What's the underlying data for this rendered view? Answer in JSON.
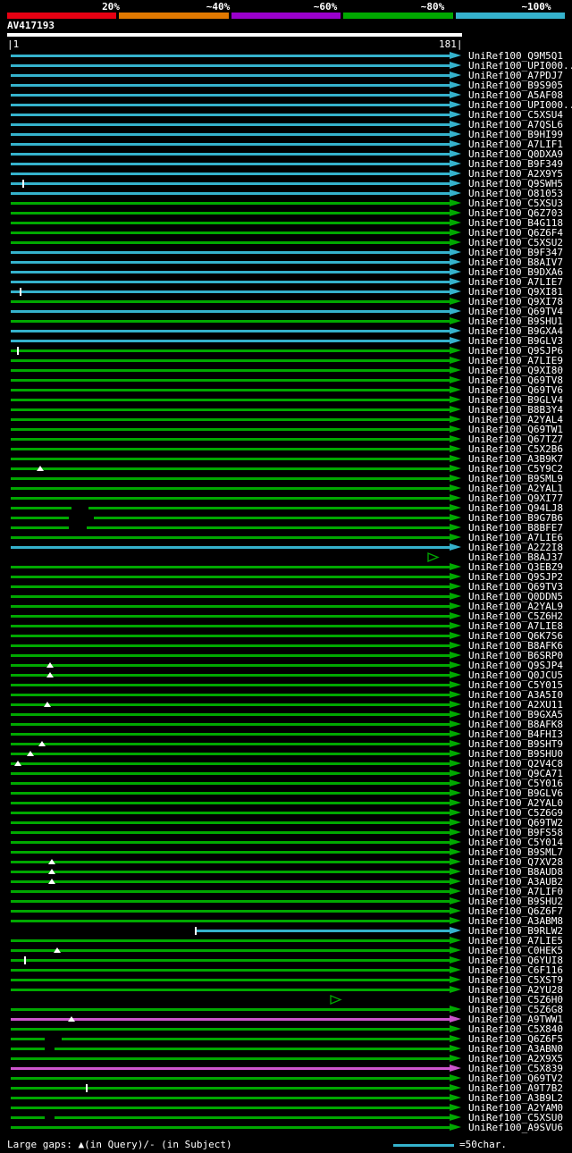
{
  "chart_data": {
    "type": "table",
    "title": "AV417193 similarity search graphical overview",
    "query_name": "AV417193",
    "ruler_left": "|1",
    "ruler_right": "181|",
    "x_range": [
      1,
      181
    ],
    "scale_labels": [
      "20%",
      "~40%",
      "~60%",
      "~80%",
      "~100%"
    ],
    "scale_colors": [
      "#e60012",
      "#e07800",
      "#9a00cc",
      "#00a800",
      "#35b2cc"
    ],
    "color_classes": {
      "cyan": "#35b2cc",
      "green": "#00a800",
      "magenta": "#cc55cc"
    },
    "legend_gaps": "Large gaps: ▲(in Query)/- (in Subject)",
    "legend_scale_label": "=50char.",
    "legend_scale_color": "#35b2cc",
    "rows": [
      {
        "label": "UniRef100_Q9M5Q1",
        "color": "cyan"
      },
      {
        "label": "UniRef100_UPI000...",
        "color": "cyan"
      },
      {
        "label": "UniRef100_A7PDJ7",
        "color": "cyan"
      },
      {
        "label": "UniRef100_B9S905",
        "color": "cyan"
      },
      {
        "label": "UniRef100_A5AF08",
        "color": "cyan"
      },
      {
        "label": "UniRef100_UPI000...",
        "color": "cyan"
      },
      {
        "label": "UniRef100_C5XSU4",
        "color": "cyan"
      },
      {
        "label": "UniRef100_A7QSL6",
        "color": "cyan"
      },
      {
        "label": "UniRef100_B9HI99",
        "color": "cyan"
      },
      {
        "label": "UniRef100_A7LIF1",
        "color": "cyan"
      },
      {
        "label": "UniRef100_Q0DXA9",
        "color": "cyan"
      },
      {
        "label": "UniRef100_B9F349",
        "color": "cyan"
      },
      {
        "label": "UniRef100_A2X9Y5",
        "color": "cyan"
      },
      {
        "label": "UniRef100_Q9SWH5",
        "color": "cyan",
        "ticks": [
          6
        ]
      },
      {
        "label": "UniRef100_O81053",
        "color": "cyan"
      },
      {
        "label": "UniRef100_C5XSU3",
        "color": "green"
      },
      {
        "label": "UniRef100_Q6Z703",
        "color": "green"
      },
      {
        "label": "UniRef100_B4G118",
        "color": "green"
      },
      {
        "label": "UniRef100_Q6Z6F4",
        "color": "green"
      },
      {
        "label": "UniRef100_C5XSU2",
        "color": "green"
      },
      {
        "label": "UniRef100_B9F347",
        "color": "cyan"
      },
      {
        "label": "UniRef100_B8AIV7",
        "color": "cyan"
      },
      {
        "label": "UniRef100_B9DXA6",
        "color": "cyan"
      },
      {
        "label": "UniRef100_A7LIE7",
        "color": "cyan"
      },
      {
        "label": "UniRef100_Q9XI81",
        "color": "cyan",
        "ticks": [
          5
        ]
      },
      {
        "label": "UniRef100_Q9XI78",
        "color": "green"
      },
      {
        "label": "UniRef100_Q69TV4",
        "color": "cyan"
      },
      {
        "label": "UniRef100_B9SHU1",
        "color": "green"
      },
      {
        "label": "UniRef100_B9GXA4",
        "color": "cyan"
      },
      {
        "label": "UniRef100_B9GLV3",
        "color": "cyan"
      },
      {
        "label": "UniRef100_Q9SJP6",
        "color": "green",
        "ticks": [
          4
        ]
      },
      {
        "label": "UniRef100_A7LIE9",
        "color": "green"
      },
      {
        "label": "UniRef100_Q9XI80",
        "color": "green"
      },
      {
        "label": "UniRef100_Q69TV8",
        "color": "green"
      },
      {
        "label": "UniRef100_Q69TV6",
        "color": "green"
      },
      {
        "label": "UniRef100_B9GLV4",
        "color": "green"
      },
      {
        "label": "UniRef100_B8B3Y4",
        "color": "green"
      },
      {
        "label": "UniRef100_A2YAL4",
        "color": "green"
      },
      {
        "label": "UniRef100_Q69TW1",
        "color": "green"
      },
      {
        "label": "UniRef100_Q67TZ7",
        "color": "green"
      },
      {
        "label": "UniRef100_C5X2B6",
        "color": "green"
      },
      {
        "label": "UniRef100_A3B9K7",
        "color": "green"
      },
      {
        "label": "UniRef100_C5Y9C2",
        "color": "green",
        "tris": [
          13
        ]
      },
      {
        "label": "UniRef100_B9SML9",
        "color": "green"
      },
      {
        "label": "UniRef100_A2YAL1",
        "color": "green"
      },
      {
        "label": "UniRef100_Q9XI77",
        "color": "green"
      },
      {
        "label": "UniRef100_Q94LJ8",
        "color": "green",
        "gaps": [
          [
            26,
            33
          ]
        ]
      },
      {
        "label": "UniRef100_B9G7B6",
        "color": "green",
        "gaps": [
          [
            25,
            35
          ]
        ]
      },
      {
        "label": "UniRef100_B8BFE7",
        "color": "green",
        "gaps": [
          [
            25,
            32
          ]
        ]
      },
      {
        "label": "UniRef100_A7LIE6",
        "color": "green"
      },
      {
        "label": "UniRef100_A2Z2I8",
        "color": "cyan"
      },
      {
        "label": "UniRef100_B8AJ37",
        "color": "green",
        "bar": null,
        "arrow": "open",
        "arrow_at": 172
      },
      {
        "label": "UniRef100_Q3EBZ9",
        "color": "green"
      },
      {
        "label": "UniRef100_Q9SJP2",
        "color": "green"
      },
      {
        "label": "UniRef100_Q69TV3",
        "color": "green"
      },
      {
        "label": "UniRef100_Q0DDN5",
        "color": "green"
      },
      {
        "label": "UniRef100_A2YAL9",
        "color": "green"
      },
      {
        "label": "UniRef100_C5Z6H2",
        "color": "green"
      },
      {
        "label": "UniRef100_A7LIE8",
        "color": "green"
      },
      {
        "label": "UniRef100_Q6K7S6",
        "color": "green"
      },
      {
        "label": "UniRef100_B8AFK6",
        "color": "green"
      },
      {
        "label": "UniRef100_B6SRP0",
        "color": "green"
      },
      {
        "label": "UniRef100_Q9SJP4",
        "color": "green",
        "tris": [
          17
        ]
      },
      {
        "label": "UniRef100_Q0JCU5",
        "color": "green",
        "tris": [
          17
        ]
      },
      {
        "label": "UniRef100_C5Y015",
        "color": "green"
      },
      {
        "label": "UniRef100_A3A5I0",
        "color": "green"
      },
      {
        "label": "UniRef100_A2XU11",
        "color": "green",
        "tris": [
          16
        ]
      },
      {
        "label": "UniRef100_B9GXA5",
        "color": "green"
      },
      {
        "label": "UniRef100_B8AFK8",
        "color": "green"
      },
      {
        "label": "UniRef100_B4FHI3",
        "color": "green"
      },
      {
        "label": "UniRef100_B9SHT9",
        "color": "green",
        "tris": [
          14
        ]
      },
      {
        "label": "UniRef100_B9SHU0",
        "color": "green",
        "tris": [
          9
        ]
      },
      {
        "label": "UniRef100_Q2V4C8",
        "color": "green",
        "tris": [
          4
        ]
      },
      {
        "label": "UniRef100_Q9CA71",
        "color": "green"
      },
      {
        "label": "UniRef100_C5Y016",
        "color": "green"
      },
      {
        "label": "UniRef100_B9GLV6",
        "color": "green"
      },
      {
        "label": "UniRef100_A2YAL0",
        "color": "green"
      },
      {
        "label": "UniRef100_C5Z6G9",
        "color": "green"
      },
      {
        "label": "UniRef100_Q69TW2",
        "color": "green"
      },
      {
        "label": "UniRef100_B9FS58",
        "color": "green"
      },
      {
        "label": "UniRef100_C5Y014",
        "color": "green"
      },
      {
        "label": "UniRef100_B9SML7",
        "color": "green"
      },
      {
        "label": "UniRef100_Q7XV28",
        "color": "green",
        "tris": [
          18
        ]
      },
      {
        "label": "UniRef100_B8AUD8",
        "color": "green",
        "tris": [
          18
        ]
      },
      {
        "label": "UniRef100_A3AUB2",
        "color": "green",
        "tris": [
          18
        ]
      },
      {
        "label": "UniRef100_A7LIF0",
        "color": "green"
      },
      {
        "label": "UniRef100_B9SHU2",
        "color": "green"
      },
      {
        "label": "UniRef100_Q6Z6F7",
        "color": "green"
      },
      {
        "label": "UniRef100_A3ABM8",
        "color": "green"
      },
      {
        "label": "UniRef100_B9RLW2",
        "color": "cyan",
        "bar": [
          77,
          181
        ],
        "ticks": [
          77
        ]
      },
      {
        "label": "UniRef100_A7LIE5",
        "color": "green"
      },
      {
        "label": "UniRef100_C0HEK5",
        "color": "green",
        "tris": [
          20
        ]
      },
      {
        "label": "UniRef100_Q6YUI8",
        "color": "green",
        "ticks": [
          7
        ]
      },
      {
        "label": "UniRef100_C6F116",
        "color": "green"
      },
      {
        "label": "UniRef100_C5XST9",
        "color": "green"
      },
      {
        "label": "UniRef100_A2YU28",
        "color": "green"
      },
      {
        "label": "UniRef100_C5Z6H0",
        "color": "green",
        "bar": null,
        "arrow": "open",
        "arrow_at": 132
      },
      {
        "label": "UniRef100_C5Z6G8",
        "color": "green"
      },
      {
        "label": "UniRef100_A9TWW1",
        "color": "magenta",
        "tris": [
          26
        ]
      },
      {
        "label": "UniRef100_C5X840",
        "color": "green"
      },
      {
        "label": "UniRef100_Q6Z6F5",
        "color": "green",
        "gaps": [
          [
            15,
            22
          ]
        ]
      },
      {
        "label": "UniRef100_A3ABN0",
        "color": "green",
        "gaps": [
          [
            15,
            19
          ]
        ]
      },
      {
        "label": "UniRef100_A2X9X5",
        "color": "green"
      },
      {
        "label": "UniRef100_C5X839",
        "color": "magenta"
      },
      {
        "label": "UniRef100_Q69TV2",
        "color": "green"
      },
      {
        "label": "UniRef100_A9T7B2",
        "color": "green",
        "ticks": [
          32
        ]
      },
      {
        "label": "UniRef100_A3B9L2",
        "color": "green"
      },
      {
        "label": "UniRef100_A2YAM0",
        "color": "green"
      },
      {
        "label": "UniRef100_C5XSU0",
        "color": "green",
        "gaps": [
          [
            15,
            19
          ]
        ]
      },
      {
        "label": "UniRef100_A9SVU6",
        "color": "green"
      }
    ]
  }
}
